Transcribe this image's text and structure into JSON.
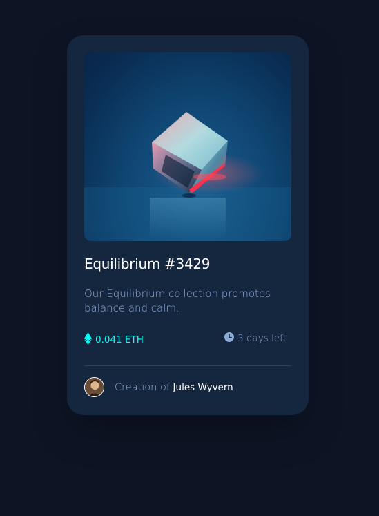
{
  "card": {
    "title": "Equilibrium #3429",
    "description": "Our Equilibrium collection promotes balance and calm.",
    "price": "0.041 ETH",
    "time_left": "3 days left",
    "creator_prefix": "Creation of",
    "creator_name": "Jules Wyvern"
  },
  "icons": {
    "price": "ethereum-icon",
    "time": "clock-icon"
  },
  "colors": {
    "page_bg": "#0d1525",
    "card_bg": "#15263f",
    "accent_cyan": "#00fff8",
    "soft_blue": "#8bacd9",
    "white": "#ffffff",
    "divider": "#2e405a"
  }
}
